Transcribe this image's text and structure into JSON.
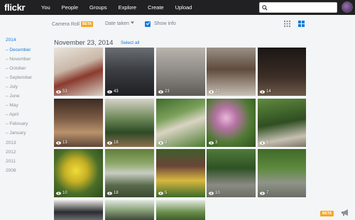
{
  "nav": {
    "logo": "flickr",
    "items": [
      "You",
      "People",
      "Groups",
      "Explore",
      "Create",
      "Upload"
    ],
    "search_placeholder": ""
  },
  "toolbar": {
    "camera_roll": "Camera Roll",
    "beta": "BETA",
    "date_taken": "Date taken",
    "show_info": "Show info"
  },
  "sidebar": {
    "year_active": "2014",
    "months": [
      "December",
      "November",
      "October",
      "September",
      "July",
      "June",
      "May",
      "April",
      "February",
      "January"
    ],
    "other_years": [
      "2013",
      "2012",
      "2011",
      "2008"
    ]
  },
  "section": {
    "date": "November 23, 2014",
    "select_all": "Select all"
  },
  "photos": [
    {
      "views": "53"
    },
    {
      "views": "43"
    },
    {
      "views": "23"
    },
    {
      "views": "22"
    },
    {
      "views": "14"
    },
    {
      "views": "13"
    },
    {
      "views": "18"
    },
    {
      "views": "9"
    },
    {
      "views": "3"
    },
    {
      "views": "9"
    },
    {
      "views": "10"
    },
    {
      "views": "18"
    },
    {
      "views": "5"
    },
    {
      "views": "10"
    },
    {
      "views": "7"
    },
    {
      "views": ""
    },
    {
      "views": ""
    },
    {
      "views": ""
    }
  ],
  "footer": {
    "beta": "BETA"
  },
  "colors": {
    "accent": "#1a7ad9",
    "beta": "#f5a623",
    "topbar": "#212124"
  }
}
